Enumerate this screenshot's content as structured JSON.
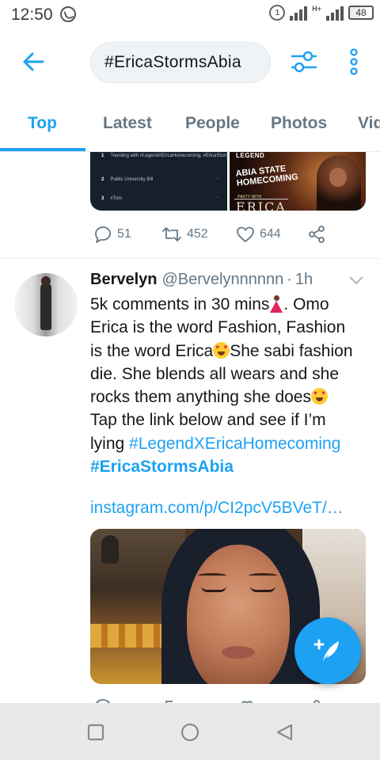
{
  "status_bar": {
    "time": "12:50",
    "battery": "48",
    "network_label": "H+"
  },
  "search": {
    "query": "#EricaStormsAbia"
  },
  "tabs": [
    {
      "label": "Top",
      "active": true
    },
    {
      "label": "Latest",
      "active": false
    },
    {
      "label": "People",
      "active": false
    },
    {
      "label": "Photos",
      "active": false
    },
    {
      "label": "Vid",
      "active": false
    }
  ],
  "prev_tweet": {
    "trends": [
      {
        "rank": "1",
        "text": "Trending with #LegendXEricaHomecoming, #EricaStormsAbia, #EricaHomecoming"
      },
      {
        "rank": "2",
        "text": "Public University Bill"
      },
      {
        "rank": "3",
        "text": "#Tom"
      }
    ],
    "poster": {
      "top": "LEGEND",
      "title": "ABIA STATE HOMECOMING",
      "subtitle": "PARTY WITH",
      "name": "ERICA"
    },
    "replies": "51",
    "retweets": "452",
    "likes": "644"
  },
  "tweet": {
    "name": "Bervelyn",
    "handle": "@Bervelynnnnnn",
    "separator": "·",
    "time": "1h",
    "lines": {
      "l1": "5k comments in 30 mins",
      "l1b": ". Omo",
      "l2": "Erica is the word Fashion, Fashion",
      "l3a": "is the word Erica",
      "l3b": "She sabi fashion",
      "l4": "die. She blends all wears and she",
      "l5": "rocks them anything she does",
      "l6": "Tap the link below and see if I’m",
      "l7a": "lying "
    },
    "hashtag1": "#LegendXEricaHomecoming",
    "hashtag2": "#EricaStormsAbia",
    "link": "instagram.com/p/CI2pcV5BVeT/…"
  },
  "colors": {
    "accent": "#1da1f2",
    "text": "#14171a",
    "muted": "#657786",
    "nav_bg": "#e9e9e9"
  },
  "icons": [
    "back-arrow-icon",
    "filter-icon",
    "more-vertical-icon",
    "reply-icon",
    "retweet-icon",
    "like-icon",
    "share-icon",
    "compose-icon",
    "square-icon",
    "circle-icon",
    "triangle-back-icon"
  ]
}
